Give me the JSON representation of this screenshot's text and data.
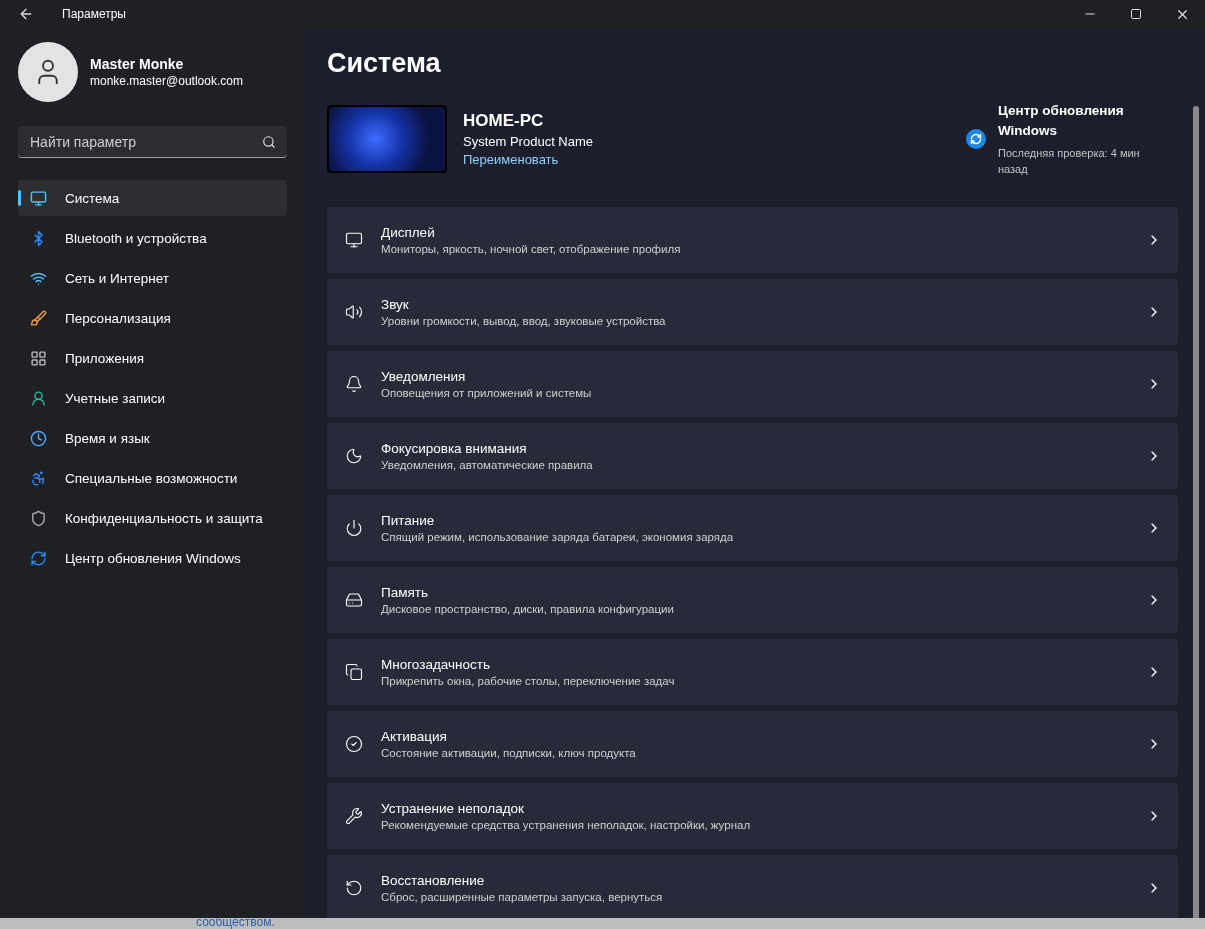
{
  "window": {
    "title": "Параметры"
  },
  "account": {
    "name": "Master Monke",
    "email": "monke.master@outlook.com"
  },
  "search": {
    "placeholder": "Найти параметр"
  },
  "sidebar": {
    "items": [
      {
        "label": "Система",
        "selected": true
      },
      {
        "label": "Bluetooth и устройства",
        "selected": false
      },
      {
        "label": "Сеть и Интернет",
        "selected": false
      },
      {
        "label": "Персонализация",
        "selected": false
      },
      {
        "label": "Приложения",
        "selected": false
      },
      {
        "label": "Учетные записи",
        "selected": false
      },
      {
        "label": "Время и язык",
        "selected": false
      },
      {
        "label": "Специальные возможности",
        "selected": false
      },
      {
        "label": "Конфиденциальность и защита",
        "selected": false
      },
      {
        "label": "Центр обновления Windows",
        "selected": false
      }
    ]
  },
  "page": {
    "title": "Система"
  },
  "device": {
    "name": "HOME-PC",
    "model": "System Product Name",
    "rename_link": "Переименовать"
  },
  "update": {
    "title": "Центр обновления Windows",
    "status": "Последняя проверка: 4 мин назад"
  },
  "settings": [
    {
      "title": "Дисплей",
      "subtitle": "Мониторы, яркость, ночной свет, отображение профиля"
    },
    {
      "title": "Звук",
      "subtitle": "Уровни громкости, вывод, ввод, звуковые устройства"
    },
    {
      "title": "Уведомления",
      "subtitle": "Оповещения от приложений и системы"
    },
    {
      "title": "Фокусировка внимания",
      "subtitle": "Уведомления, автоматические правила"
    },
    {
      "title": "Питание",
      "subtitle": "Спящий режим, использование заряда батареи, экономия заряда"
    },
    {
      "title": "Память",
      "subtitle": "Дисковое пространство, диски, правила конфигурации"
    },
    {
      "title": "Многозадачность",
      "subtitle": "Прикрепить окна, рабочие столы, переключение задач"
    },
    {
      "title": "Активация",
      "subtitle": "Состояние активации, подписки, ключ продукта"
    },
    {
      "title": "Устранение неполадок",
      "subtitle": "Рекомендуемые средства устранения неполадок, настройки, журнал"
    },
    {
      "title": "Восстановление",
      "subtitle": "Сброс, расширенные параметры запуска, вернуться"
    }
  ],
  "background_page": {
    "text": "сообществом."
  }
}
